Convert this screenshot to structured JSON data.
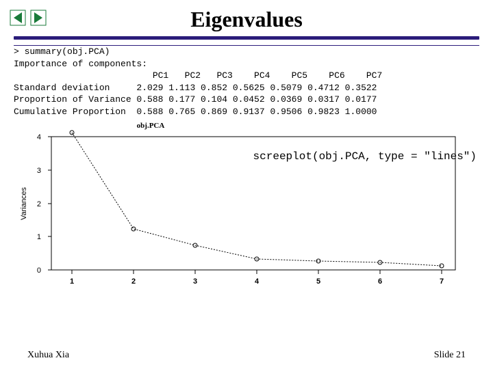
{
  "title": "Eigenvalues",
  "console": {
    "line1": "> summary(obj.PCA)",
    "line2": "Importance of components:",
    "header": "                          PC1   PC2   PC3    PC4    PC5    PC6    PC7",
    "row_sd": "Standard deviation     2.029 1.113 0.852 0.5625 0.5079 0.4712 0.3522",
    "row_pv": "Proportion of Variance 0.588 0.177 0.104 0.0452 0.0369 0.0317 0.0177",
    "row_cp": "Cumulative Proportion  0.588 0.765 0.869 0.9137 0.9506 0.9823 1.0000"
  },
  "chart_data": {
    "type": "line",
    "title": "obj.PCA",
    "xlabel": "",
    "ylabel": "Variances",
    "x": [
      1,
      2,
      3,
      4,
      5,
      6,
      7
    ],
    "y_ticks": [
      0,
      1,
      2,
      3,
      4
    ],
    "values": [
      4.12,
      1.24,
      0.73,
      0.32,
      0.26,
      0.22,
      0.12
    ]
  },
  "code_overlay": "screeplot(obj.PCA, type = \"lines\")",
  "footer": {
    "author": "Xuhua Xia",
    "slide": "Slide 21"
  },
  "icons": {
    "prev": "prev-arrow-icon",
    "next": "next-arrow-icon"
  }
}
